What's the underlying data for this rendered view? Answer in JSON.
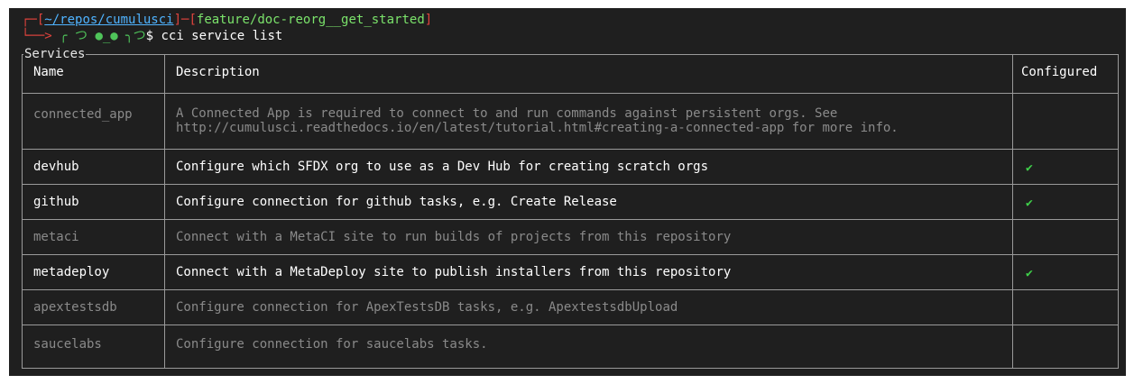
{
  "prompt": {
    "path": "~/repos/cumulusci",
    "branch": "feature/doc-reorg__get_started",
    "face": "╭ つ ●_● ╮つ",
    "dollar": "$",
    "command": "cci service list"
  },
  "table": {
    "title": "Services",
    "headers": {
      "name": "Name",
      "description": "Description",
      "configured": "Configured"
    },
    "rows": [
      {
        "name": "connected_app",
        "description": "A Connected App is required to connect to and run commands against persistent orgs. See",
        "description2": "http://cumulusci.readthedocs.io/en/latest/tutorial.html#creating-a-connected-app for more info.",
        "configured": "",
        "bright": false
      },
      {
        "name": "devhub",
        "description": "Configure which SFDX org to use as a Dev Hub for creating scratch orgs",
        "configured": "✔",
        "bright": true
      },
      {
        "name": "github",
        "description": "Configure connection for github tasks, e.g. Create Release",
        "configured": "✔",
        "bright": true
      },
      {
        "name": "metaci",
        "description": "Connect with a MetaCI site to run builds of projects from this repository",
        "configured": "",
        "bright": false
      },
      {
        "name": "metadeploy",
        "description": "Connect with a MetaDeploy site to publish installers from this repository",
        "configured": "✔",
        "bright": true
      },
      {
        "name": "apextestsdb",
        "description": "Configure connection for ApexTestsDB tasks, e.g. ApextestsdbUpload",
        "configured": "",
        "bright": false
      },
      {
        "name": "saucelabs",
        "description": "Configure connection for saucelabs tasks.",
        "configured": "",
        "bright": false
      }
    ]
  },
  "colors": {
    "terminal_bg": "#1f1f1f",
    "prompt_red": "#e0433d",
    "path_blue": "#4fb3ff",
    "branch_green": "#7be36b",
    "check_green": "#3fd04a",
    "dim_text": "#8a8a8a"
  }
}
